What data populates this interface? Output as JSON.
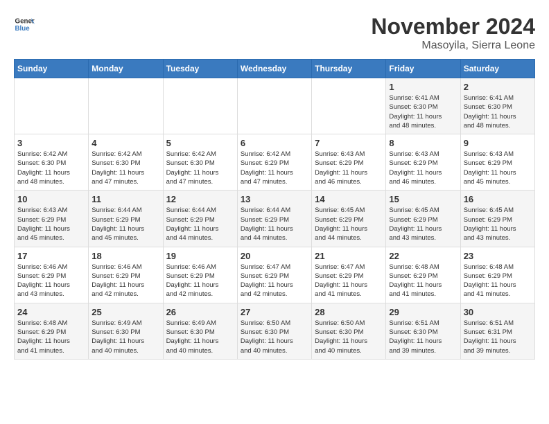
{
  "header": {
    "logo_line1": "General",
    "logo_line2": "Blue",
    "title": "November 2024",
    "subtitle": "Masoyila, Sierra Leone"
  },
  "weekdays": [
    "Sunday",
    "Monday",
    "Tuesday",
    "Wednesday",
    "Thursday",
    "Friday",
    "Saturday"
  ],
  "weeks": [
    [
      {
        "day": "",
        "info": ""
      },
      {
        "day": "",
        "info": ""
      },
      {
        "day": "",
        "info": ""
      },
      {
        "day": "",
        "info": ""
      },
      {
        "day": "",
        "info": ""
      },
      {
        "day": "1",
        "info": "Sunrise: 6:41 AM\nSunset: 6:30 PM\nDaylight: 11 hours\nand 48 minutes."
      },
      {
        "day": "2",
        "info": "Sunrise: 6:41 AM\nSunset: 6:30 PM\nDaylight: 11 hours\nand 48 minutes."
      }
    ],
    [
      {
        "day": "3",
        "info": "Sunrise: 6:42 AM\nSunset: 6:30 PM\nDaylight: 11 hours\nand 48 minutes."
      },
      {
        "day": "4",
        "info": "Sunrise: 6:42 AM\nSunset: 6:30 PM\nDaylight: 11 hours\nand 47 minutes."
      },
      {
        "day": "5",
        "info": "Sunrise: 6:42 AM\nSunset: 6:30 PM\nDaylight: 11 hours\nand 47 minutes."
      },
      {
        "day": "6",
        "info": "Sunrise: 6:42 AM\nSunset: 6:29 PM\nDaylight: 11 hours\nand 47 minutes."
      },
      {
        "day": "7",
        "info": "Sunrise: 6:43 AM\nSunset: 6:29 PM\nDaylight: 11 hours\nand 46 minutes."
      },
      {
        "day": "8",
        "info": "Sunrise: 6:43 AM\nSunset: 6:29 PM\nDaylight: 11 hours\nand 46 minutes."
      },
      {
        "day": "9",
        "info": "Sunrise: 6:43 AM\nSunset: 6:29 PM\nDaylight: 11 hours\nand 45 minutes."
      }
    ],
    [
      {
        "day": "10",
        "info": "Sunrise: 6:43 AM\nSunset: 6:29 PM\nDaylight: 11 hours\nand 45 minutes."
      },
      {
        "day": "11",
        "info": "Sunrise: 6:44 AM\nSunset: 6:29 PM\nDaylight: 11 hours\nand 45 minutes."
      },
      {
        "day": "12",
        "info": "Sunrise: 6:44 AM\nSunset: 6:29 PM\nDaylight: 11 hours\nand 44 minutes."
      },
      {
        "day": "13",
        "info": "Sunrise: 6:44 AM\nSunset: 6:29 PM\nDaylight: 11 hours\nand 44 minutes."
      },
      {
        "day": "14",
        "info": "Sunrise: 6:45 AM\nSunset: 6:29 PM\nDaylight: 11 hours\nand 44 minutes."
      },
      {
        "day": "15",
        "info": "Sunrise: 6:45 AM\nSunset: 6:29 PM\nDaylight: 11 hours\nand 43 minutes."
      },
      {
        "day": "16",
        "info": "Sunrise: 6:45 AM\nSunset: 6:29 PM\nDaylight: 11 hours\nand 43 minutes."
      }
    ],
    [
      {
        "day": "17",
        "info": "Sunrise: 6:46 AM\nSunset: 6:29 PM\nDaylight: 11 hours\nand 43 minutes."
      },
      {
        "day": "18",
        "info": "Sunrise: 6:46 AM\nSunset: 6:29 PM\nDaylight: 11 hours\nand 42 minutes."
      },
      {
        "day": "19",
        "info": "Sunrise: 6:46 AM\nSunset: 6:29 PM\nDaylight: 11 hours\nand 42 minutes."
      },
      {
        "day": "20",
        "info": "Sunrise: 6:47 AM\nSunset: 6:29 PM\nDaylight: 11 hours\nand 42 minutes."
      },
      {
        "day": "21",
        "info": "Sunrise: 6:47 AM\nSunset: 6:29 PM\nDaylight: 11 hours\nand 41 minutes."
      },
      {
        "day": "22",
        "info": "Sunrise: 6:48 AM\nSunset: 6:29 PM\nDaylight: 11 hours\nand 41 minutes."
      },
      {
        "day": "23",
        "info": "Sunrise: 6:48 AM\nSunset: 6:29 PM\nDaylight: 11 hours\nand 41 minutes."
      }
    ],
    [
      {
        "day": "24",
        "info": "Sunrise: 6:48 AM\nSunset: 6:29 PM\nDaylight: 11 hours\nand 41 minutes."
      },
      {
        "day": "25",
        "info": "Sunrise: 6:49 AM\nSunset: 6:30 PM\nDaylight: 11 hours\nand 40 minutes."
      },
      {
        "day": "26",
        "info": "Sunrise: 6:49 AM\nSunset: 6:30 PM\nDaylight: 11 hours\nand 40 minutes."
      },
      {
        "day": "27",
        "info": "Sunrise: 6:50 AM\nSunset: 6:30 PM\nDaylight: 11 hours\nand 40 minutes."
      },
      {
        "day": "28",
        "info": "Sunrise: 6:50 AM\nSunset: 6:30 PM\nDaylight: 11 hours\nand 40 minutes."
      },
      {
        "day": "29",
        "info": "Sunrise: 6:51 AM\nSunset: 6:30 PM\nDaylight: 11 hours\nand 39 minutes."
      },
      {
        "day": "30",
        "info": "Sunrise: 6:51 AM\nSunset: 6:31 PM\nDaylight: 11 hours\nand 39 minutes."
      }
    ]
  ]
}
